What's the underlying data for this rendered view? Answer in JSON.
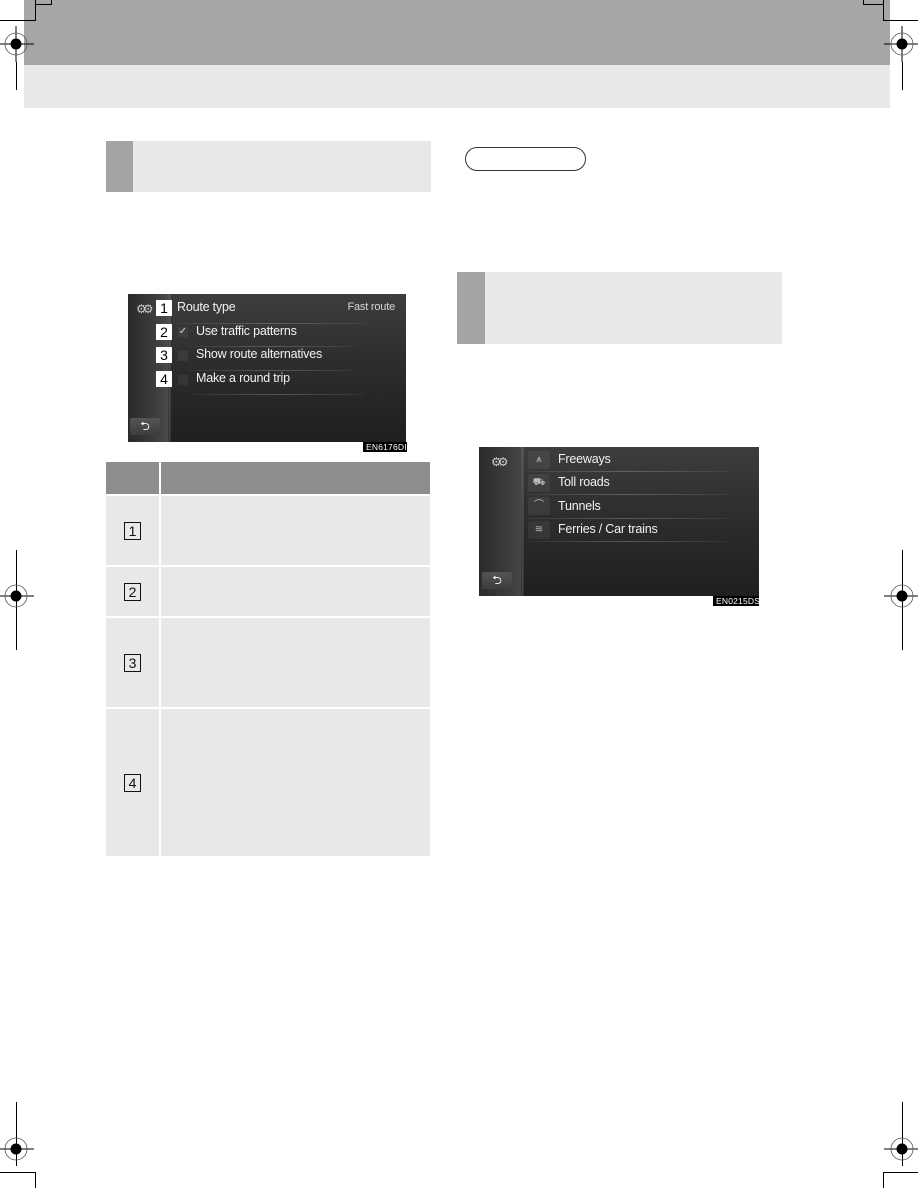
{
  "page": {
    "header": {
      "band_color": "#a7a5a6",
      "subband_color": "#e8e8e8"
    }
  },
  "left_section": {
    "heading": "",
    "screen": {
      "rows": [
        {
          "callout": "1",
          "label": "Route type",
          "value": "Fast route",
          "control": "none"
        },
        {
          "callout": "2",
          "label": "Use traffic patterns",
          "control": "checkbox",
          "checked": true
        },
        {
          "callout": "3",
          "label": "Show route alternatives",
          "control": "checkbox",
          "checked": false
        },
        {
          "callout": "4",
          "label": "Make a round trip",
          "control": "checkbox",
          "checked": false
        }
      ],
      "back_icon": "back-arrow-icon",
      "settings_icon": "gears-icon",
      "check_glyph": "✓",
      "back_glyph": "⮌",
      "figure_code": "EN6176DI"
    },
    "table": {
      "headers": [
        "",
        ""
      ],
      "rows": [
        {
          "num": "1",
          "desc": ""
        },
        {
          "num": "2",
          "desc": ""
        },
        {
          "num": "3",
          "desc": ""
        },
        {
          "num": "4",
          "desc": ""
        }
      ]
    }
  },
  "right_section": {
    "info_label": "",
    "heading": "",
    "screen": {
      "rows": [
        {
          "icon": "freeway-icon",
          "glyph": "⩚",
          "label": "Freeways"
        },
        {
          "icon": "toll-road-icon",
          "glyph": "⛟",
          "label": "Toll roads"
        },
        {
          "icon": "tunnel-icon",
          "glyph": "⌒",
          "label": "Tunnels"
        },
        {
          "icon": "ferry-icon",
          "glyph": "≋",
          "label": "Ferries / Car trains"
        }
      ],
      "settings_icon": "gears-icon",
      "back_glyph": "⮌",
      "figure_code": "EN0215DS"
    }
  },
  "glyphs": {
    "gears": "⚙⚙"
  }
}
